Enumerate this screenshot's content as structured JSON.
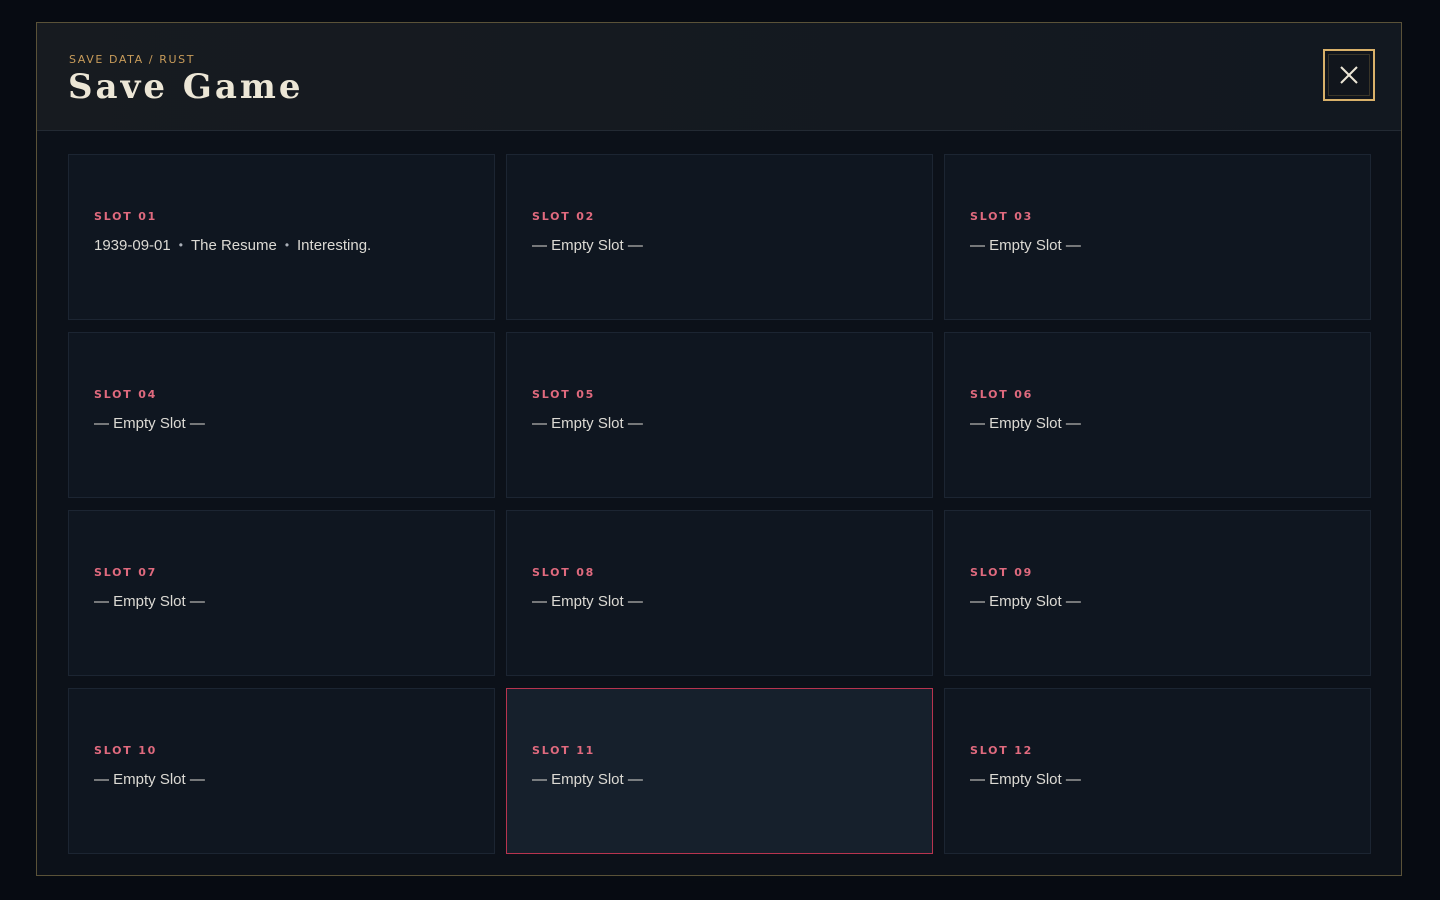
{
  "header": {
    "breadcrumb": "SAVE DATA / RUST",
    "title": "Save Game",
    "close_icon": "close-icon"
  },
  "colors": {
    "accent_gold": "#d9b16a",
    "slot_label": "#e06a7e",
    "selected_border": "#b8344f"
  },
  "slots": [
    {
      "label": "SLOT 01",
      "filled": true,
      "date": "1939-09-01",
      "chapter": "The Resume",
      "note": "Interesting.",
      "selected": false
    },
    {
      "label": "SLOT 02",
      "filled": false,
      "text": "— Empty Slot —",
      "selected": false
    },
    {
      "label": "SLOT 03",
      "filled": false,
      "text": "— Empty Slot —",
      "selected": false
    },
    {
      "label": "SLOT 04",
      "filled": false,
      "text": "— Empty Slot —",
      "selected": false
    },
    {
      "label": "SLOT 05",
      "filled": false,
      "text": "— Empty Slot —",
      "selected": false
    },
    {
      "label": "SLOT 06",
      "filled": false,
      "text": "— Empty Slot —",
      "selected": false
    },
    {
      "label": "SLOT 07",
      "filled": false,
      "text": "— Empty Slot —",
      "selected": false
    },
    {
      "label": "SLOT 08",
      "filled": false,
      "text": "— Empty Slot —",
      "selected": false
    },
    {
      "label": "SLOT 09",
      "filled": false,
      "text": "— Empty Slot —",
      "selected": false
    },
    {
      "label": "SLOT 10",
      "filled": false,
      "text": "— Empty Slot —",
      "selected": false
    },
    {
      "label": "SLOT 11",
      "filled": false,
      "text": "— Empty Slot —",
      "selected": true
    },
    {
      "label": "SLOT 12",
      "filled": false,
      "text": "— Empty Slot —",
      "selected": false
    }
  ]
}
